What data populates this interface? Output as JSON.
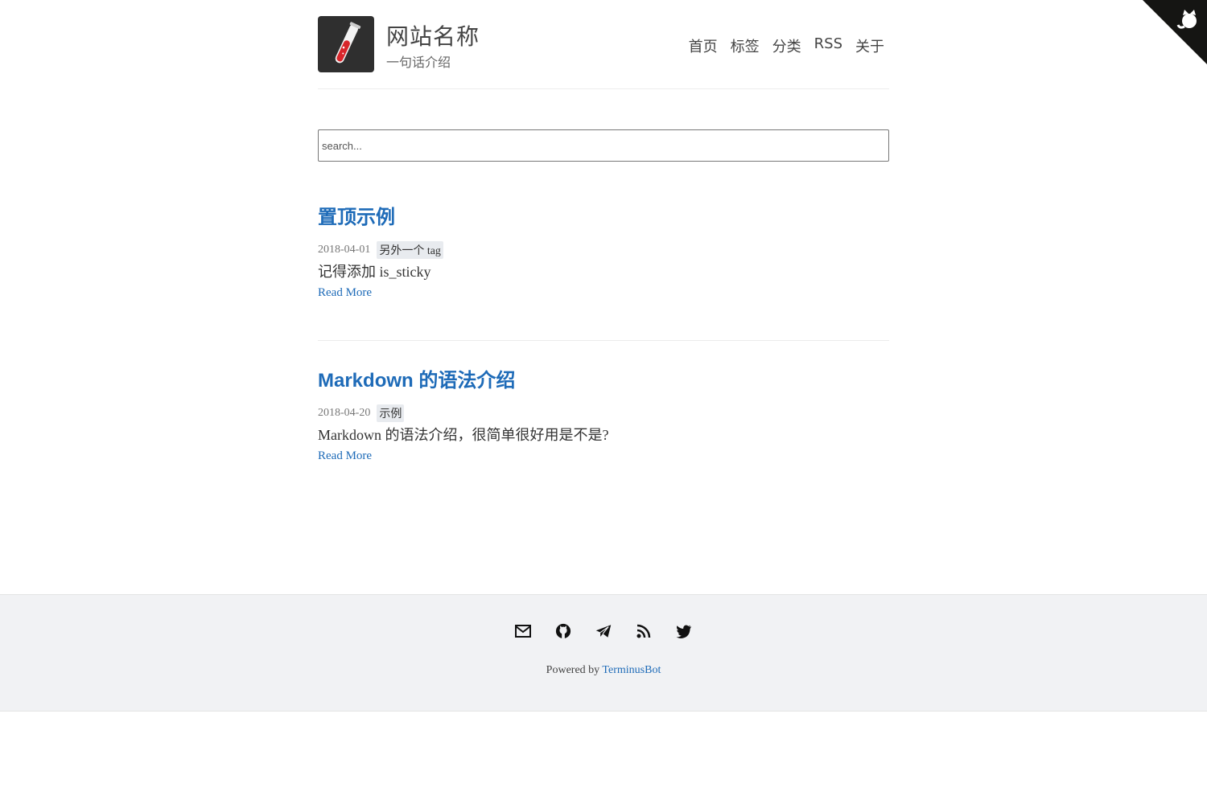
{
  "header": {
    "site_title": "网站名称",
    "site_description": "一句话介绍",
    "nav": [
      "首页",
      "标签",
      "分类",
      "RSS",
      "关于"
    ]
  },
  "search": {
    "placeholder": "search..."
  },
  "posts": [
    {
      "title": "置顶示例",
      "date": "2018-04-01",
      "tag": "另外一个 tag",
      "excerpt": "记得添加 is_sticky",
      "read_more": "Read More"
    },
    {
      "title": "Markdown 的语法介绍",
      "date": "2018-04-20",
      "tag": "示例",
      "excerpt": "Markdown 的语法介绍，很简单很好用是不是?",
      "read_more": "Read More"
    }
  ],
  "footer": {
    "social_icons": [
      "email-icon",
      "github-icon",
      "telegram-icon",
      "rss-icon",
      "twitter-icon"
    ],
    "powered_by": "Powered by",
    "powered_link": "TerminusBot"
  },
  "colors": {
    "accent": "#1e6bb8",
    "footer_bg": "#f1f2f4",
    "logo_bg": "#2f2f2f"
  }
}
